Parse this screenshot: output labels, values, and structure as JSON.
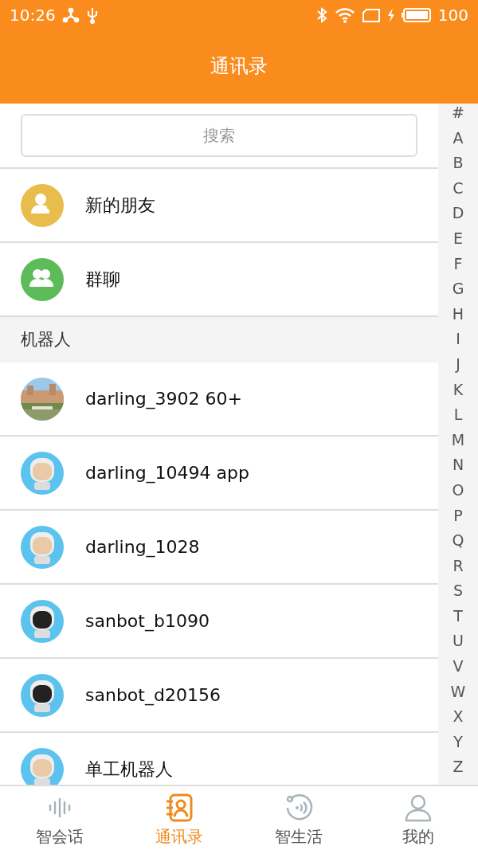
{
  "status_bar": {
    "time": "10:26",
    "battery": "100"
  },
  "header": {
    "title": "通讯录"
  },
  "search": {
    "placeholder": "搜索"
  },
  "entries": [
    {
      "label": "新的朋友",
      "kind": "new-friend"
    },
    {
      "label": "群聊",
      "kind": "group"
    }
  ],
  "section": {
    "title": "机器人"
  },
  "robots": [
    {
      "name": "darling_3902 60+",
      "kind": "picture"
    },
    {
      "name": "darling_10494 app",
      "kind": "robot-light"
    },
    {
      "name": "darling_1028",
      "kind": "robot-light"
    },
    {
      "name": "sanbot_b1090",
      "kind": "robot-dark"
    },
    {
      "name": "sanbot_d20156",
      "kind": "robot-dark"
    },
    {
      "name": "单工机器人",
      "kind": "robot-light"
    }
  ],
  "index": [
    "#",
    "A",
    "B",
    "C",
    "D",
    "E",
    "F",
    "G",
    "H",
    "I",
    "J",
    "K",
    "L",
    "M",
    "N",
    "O",
    "P",
    "Q",
    "R",
    "S",
    "T",
    "U",
    "V",
    "W",
    "X",
    "Y",
    "Z"
  ],
  "tabs": [
    {
      "label": "智会话",
      "kind": "voice",
      "selected": false
    },
    {
      "label": "通讯录",
      "kind": "contacts",
      "selected": true
    },
    {
      "label": "智生活",
      "kind": "life",
      "selected": false
    },
    {
      "label": "我的",
      "kind": "me",
      "selected": false
    }
  ]
}
